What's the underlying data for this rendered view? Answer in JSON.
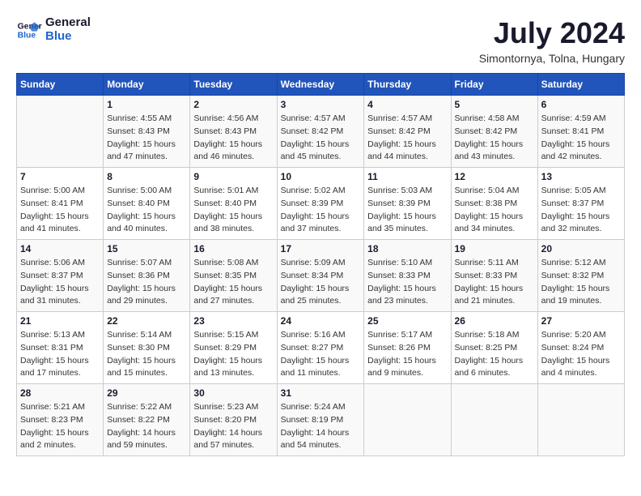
{
  "header": {
    "logo_line1": "General",
    "logo_line2": "Blue",
    "month_year": "July 2024",
    "location": "Simontornya, Tolna, Hungary"
  },
  "weekdays": [
    "Sunday",
    "Monday",
    "Tuesday",
    "Wednesday",
    "Thursday",
    "Friday",
    "Saturday"
  ],
  "weeks": [
    [
      {
        "day": "",
        "info": ""
      },
      {
        "day": "1",
        "info": "Sunrise: 4:55 AM\nSunset: 8:43 PM\nDaylight: 15 hours\nand 47 minutes."
      },
      {
        "day": "2",
        "info": "Sunrise: 4:56 AM\nSunset: 8:43 PM\nDaylight: 15 hours\nand 46 minutes."
      },
      {
        "day": "3",
        "info": "Sunrise: 4:57 AM\nSunset: 8:42 PM\nDaylight: 15 hours\nand 45 minutes."
      },
      {
        "day": "4",
        "info": "Sunrise: 4:57 AM\nSunset: 8:42 PM\nDaylight: 15 hours\nand 44 minutes."
      },
      {
        "day": "5",
        "info": "Sunrise: 4:58 AM\nSunset: 8:42 PM\nDaylight: 15 hours\nand 43 minutes."
      },
      {
        "day": "6",
        "info": "Sunrise: 4:59 AM\nSunset: 8:41 PM\nDaylight: 15 hours\nand 42 minutes."
      }
    ],
    [
      {
        "day": "7",
        "info": "Sunrise: 5:00 AM\nSunset: 8:41 PM\nDaylight: 15 hours\nand 41 minutes."
      },
      {
        "day": "8",
        "info": "Sunrise: 5:00 AM\nSunset: 8:40 PM\nDaylight: 15 hours\nand 40 minutes."
      },
      {
        "day": "9",
        "info": "Sunrise: 5:01 AM\nSunset: 8:40 PM\nDaylight: 15 hours\nand 38 minutes."
      },
      {
        "day": "10",
        "info": "Sunrise: 5:02 AM\nSunset: 8:39 PM\nDaylight: 15 hours\nand 37 minutes."
      },
      {
        "day": "11",
        "info": "Sunrise: 5:03 AM\nSunset: 8:39 PM\nDaylight: 15 hours\nand 35 minutes."
      },
      {
        "day": "12",
        "info": "Sunrise: 5:04 AM\nSunset: 8:38 PM\nDaylight: 15 hours\nand 34 minutes."
      },
      {
        "day": "13",
        "info": "Sunrise: 5:05 AM\nSunset: 8:37 PM\nDaylight: 15 hours\nand 32 minutes."
      }
    ],
    [
      {
        "day": "14",
        "info": "Sunrise: 5:06 AM\nSunset: 8:37 PM\nDaylight: 15 hours\nand 31 minutes."
      },
      {
        "day": "15",
        "info": "Sunrise: 5:07 AM\nSunset: 8:36 PM\nDaylight: 15 hours\nand 29 minutes."
      },
      {
        "day": "16",
        "info": "Sunrise: 5:08 AM\nSunset: 8:35 PM\nDaylight: 15 hours\nand 27 minutes."
      },
      {
        "day": "17",
        "info": "Sunrise: 5:09 AM\nSunset: 8:34 PM\nDaylight: 15 hours\nand 25 minutes."
      },
      {
        "day": "18",
        "info": "Sunrise: 5:10 AM\nSunset: 8:33 PM\nDaylight: 15 hours\nand 23 minutes."
      },
      {
        "day": "19",
        "info": "Sunrise: 5:11 AM\nSunset: 8:33 PM\nDaylight: 15 hours\nand 21 minutes."
      },
      {
        "day": "20",
        "info": "Sunrise: 5:12 AM\nSunset: 8:32 PM\nDaylight: 15 hours\nand 19 minutes."
      }
    ],
    [
      {
        "day": "21",
        "info": "Sunrise: 5:13 AM\nSunset: 8:31 PM\nDaylight: 15 hours\nand 17 minutes."
      },
      {
        "day": "22",
        "info": "Sunrise: 5:14 AM\nSunset: 8:30 PM\nDaylight: 15 hours\nand 15 minutes."
      },
      {
        "day": "23",
        "info": "Sunrise: 5:15 AM\nSunset: 8:29 PM\nDaylight: 15 hours\nand 13 minutes."
      },
      {
        "day": "24",
        "info": "Sunrise: 5:16 AM\nSunset: 8:27 PM\nDaylight: 15 hours\nand 11 minutes."
      },
      {
        "day": "25",
        "info": "Sunrise: 5:17 AM\nSunset: 8:26 PM\nDaylight: 15 hours\nand 9 minutes."
      },
      {
        "day": "26",
        "info": "Sunrise: 5:18 AM\nSunset: 8:25 PM\nDaylight: 15 hours\nand 6 minutes."
      },
      {
        "day": "27",
        "info": "Sunrise: 5:20 AM\nSunset: 8:24 PM\nDaylight: 15 hours\nand 4 minutes."
      }
    ],
    [
      {
        "day": "28",
        "info": "Sunrise: 5:21 AM\nSunset: 8:23 PM\nDaylight: 15 hours\nand 2 minutes."
      },
      {
        "day": "29",
        "info": "Sunrise: 5:22 AM\nSunset: 8:22 PM\nDaylight: 14 hours\nand 59 minutes."
      },
      {
        "day": "30",
        "info": "Sunrise: 5:23 AM\nSunset: 8:20 PM\nDaylight: 14 hours\nand 57 minutes."
      },
      {
        "day": "31",
        "info": "Sunrise: 5:24 AM\nSunset: 8:19 PM\nDaylight: 14 hours\nand 54 minutes."
      },
      {
        "day": "",
        "info": ""
      },
      {
        "day": "",
        "info": ""
      },
      {
        "day": "",
        "info": ""
      }
    ]
  ]
}
